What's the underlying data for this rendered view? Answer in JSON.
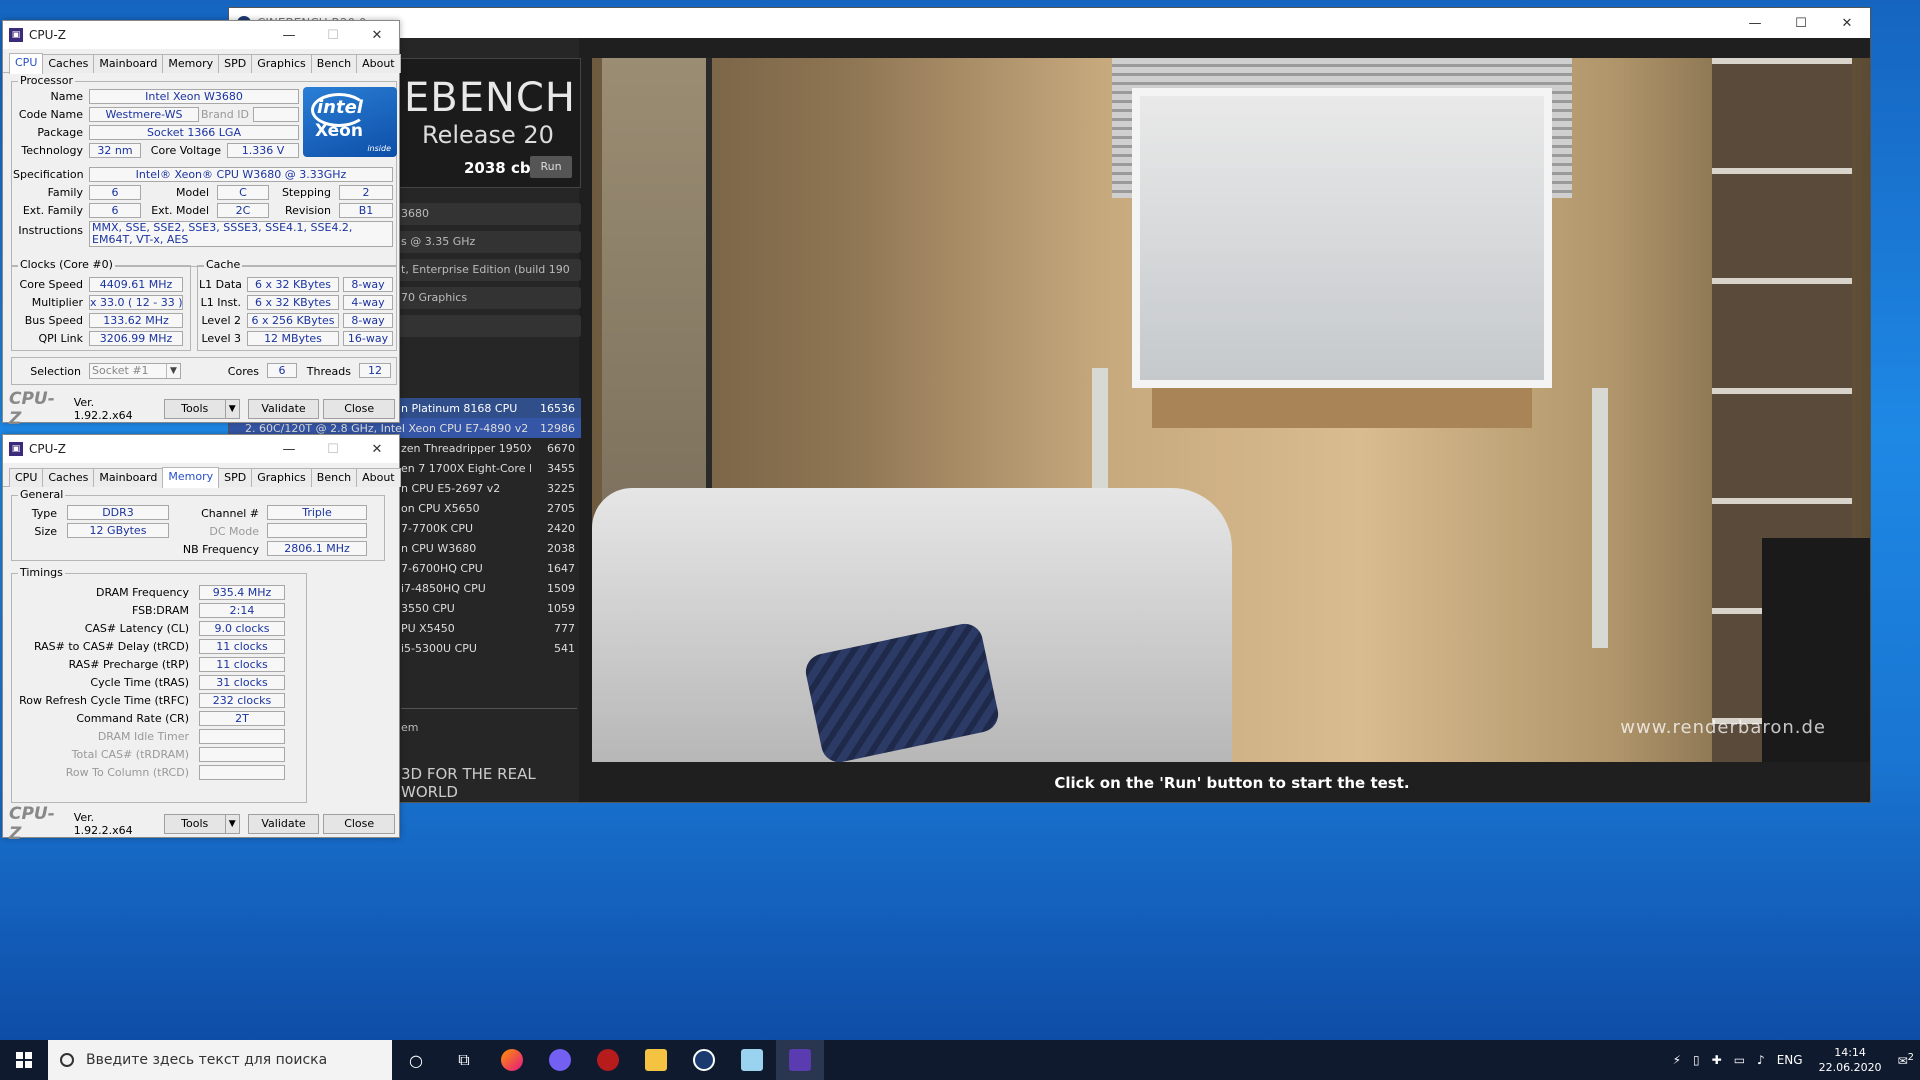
{
  "cinebench": {
    "title": "CINEBENCH R20.0",
    "logo_main": "EBENCH",
    "logo_sub": "Release 20",
    "score": "2038 cb",
    "run_label": "Run",
    "sys_lines": [
      "3680",
      "s @ 3.35 GHz",
      "t, Enterprise Edition (build 190",
      "70 Graphics",
      ""
    ],
    "ranking": [
      {
        "name": "n Platinum 8168 CPU",
        "score": "16536"
      },
      {
        "name": "2. 60C/120T @ 2.8 GHz, Intel Xeon CPU E7-4890 v2",
        "score": "12986"
      },
      {
        "name": "zen Threadripper 1950X",
        "score": "6670"
      },
      {
        "name": "en 7 1700X Eight-Core Pr",
        "score": "3455"
      },
      {
        "name": "n CPU E5-2697 v2",
        "score": "3225"
      },
      {
        "name": "on CPU X5650",
        "score": "2705"
      },
      {
        "name": "7-7700K CPU",
        "score": "2420"
      },
      {
        "name": "n CPU W3680",
        "score": "2038"
      },
      {
        "name": "7-6700HQ CPU",
        "score": "1647"
      },
      {
        "name": "i7-4850HQ CPU",
        "score": "1509"
      },
      {
        "name": "3550 CPU",
        "score": "1059"
      },
      {
        "name": "PU X5450",
        "score": "777"
      },
      {
        "name": "i5-5300U CPU",
        "score": "541"
      }
    ],
    "footer_item": "em",
    "tagline": "3D FOR THE REAL WORLD",
    "watermark": "www.renderbaron.de",
    "status": "Click on the 'Run' button to start the test."
  },
  "cpuz1": {
    "title": "CPU-Z",
    "tabs": [
      "CPU",
      "Caches",
      "Mainboard",
      "Memory",
      "SPD",
      "Graphics",
      "Bench",
      "About"
    ],
    "processor_group": "Processor",
    "name_label": "Name",
    "name": "Intel Xeon W3680",
    "codename_label": "Code Name",
    "codename": "Westmere-WS",
    "brandid_label": "Brand ID",
    "package_label": "Package",
    "package": "Socket 1366 LGA",
    "technology_label": "Technology",
    "technology": "32 nm",
    "corevoltage_label": "Core Voltage",
    "corevoltage": "1.336 V",
    "spec_label": "Specification",
    "spec": "Intel® Xeon® CPU        W3680  @ 3.33GHz",
    "family_label": "Family",
    "family": "6",
    "model_label": "Model",
    "model": "C",
    "stepping_label": "Stepping",
    "stepping": "2",
    "extfamily_label": "Ext. Family",
    "extfamily": "6",
    "extmodel_label": "Ext. Model",
    "extmodel": "2C",
    "revision_label": "Revision",
    "revision": "B1",
    "instructions_label": "Instructions",
    "instructions": "MMX, SSE, SSE2, SSE3, SSSE3, SSE4.1, SSE4.2, EM64T, VT-x, AES",
    "logo": {
      "t1": "intel",
      "t2": "Xeon",
      "t3": "inside"
    },
    "clocks_group": "Clocks (Core #0)",
    "corespeed_label": "Core Speed",
    "corespeed": "4409.61 MHz",
    "multiplier_label": "Multiplier",
    "multiplier": "x 33.0 ( 12 - 33 )",
    "busspeed_label": "Bus Speed",
    "busspeed": "133.62 MHz",
    "qpi_label": "QPI Link",
    "qpi": "3206.99 MHz",
    "cache_group": "Cache",
    "l1d_label": "L1 Data",
    "l1d": "6 x 32 KBytes",
    "l1d_way": "8-way",
    "l1i_label": "L1 Inst.",
    "l1i": "6 x 32 KBytes",
    "l1i_way": "4-way",
    "l2_label": "Level 2",
    "l2": "6 x 256 KBytes",
    "l2_way": "8-way",
    "l3_label": "Level 3",
    "l3": "12 MBytes",
    "l3_way": "16-way",
    "selection_label": "Selection",
    "selection": "Socket #1",
    "cores_label": "Cores",
    "cores": "6",
    "threads_label": "Threads",
    "threads": "12",
    "logo_text": "CPU-Z",
    "version": "Ver. 1.92.2.x64",
    "tools": "Tools",
    "validate": "Validate",
    "close": "Close"
  },
  "cpuz2": {
    "title": "CPU-Z",
    "tabs": [
      "CPU",
      "Caches",
      "Mainboard",
      "Memory",
      "SPD",
      "Graphics",
      "Bench",
      "About"
    ],
    "general_group": "General",
    "type_label": "Type",
    "type": "DDR3",
    "size_label": "Size",
    "size": "12 GBytes",
    "channel_label": "Channel #",
    "channel": "Triple",
    "dcmode_label": "DC Mode",
    "nbfreq_label": "NB Frequency",
    "nbfreq": "2806.1 MHz",
    "timings_group": "Timings",
    "timings": [
      {
        "label": "DRAM Frequency",
        "value": "935.4 MHz"
      },
      {
        "label": "FSB:DRAM",
        "value": "2:14"
      },
      {
        "label": "CAS# Latency (CL)",
        "value": "9.0 clocks"
      },
      {
        "label": "RAS# to CAS# Delay (tRCD)",
        "value": "11 clocks"
      },
      {
        "label": "RAS# Precharge (tRP)",
        "value": "11 clocks"
      },
      {
        "label": "Cycle Time (tRAS)",
        "value": "31 clocks"
      },
      {
        "label": "Row Refresh Cycle Time (tRFC)",
        "value": "232 clocks"
      },
      {
        "label": "Command Rate (CR)",
        "value": "2T"
      }
    ],
    "dim_timings": [
      "DRAM Idle Timer",
      "Total CAS# (tRDRAM)",
      "Row To Column (tRCD)"
    ],
    "logo_text": "CPU-Z",
    "version": "Ver. 1.92.2.x64",
    "tools": "Tools",
    "validate": "Validate",
    "close": "Close"
  },
  "taskbar": {
    "search_placeholder": "Введите здесь текст для поиска",
    "lang": "ENG",
    "time": "14:14",
    "date": "22.06.2020",
    "notif_count": "2"
  }
}
